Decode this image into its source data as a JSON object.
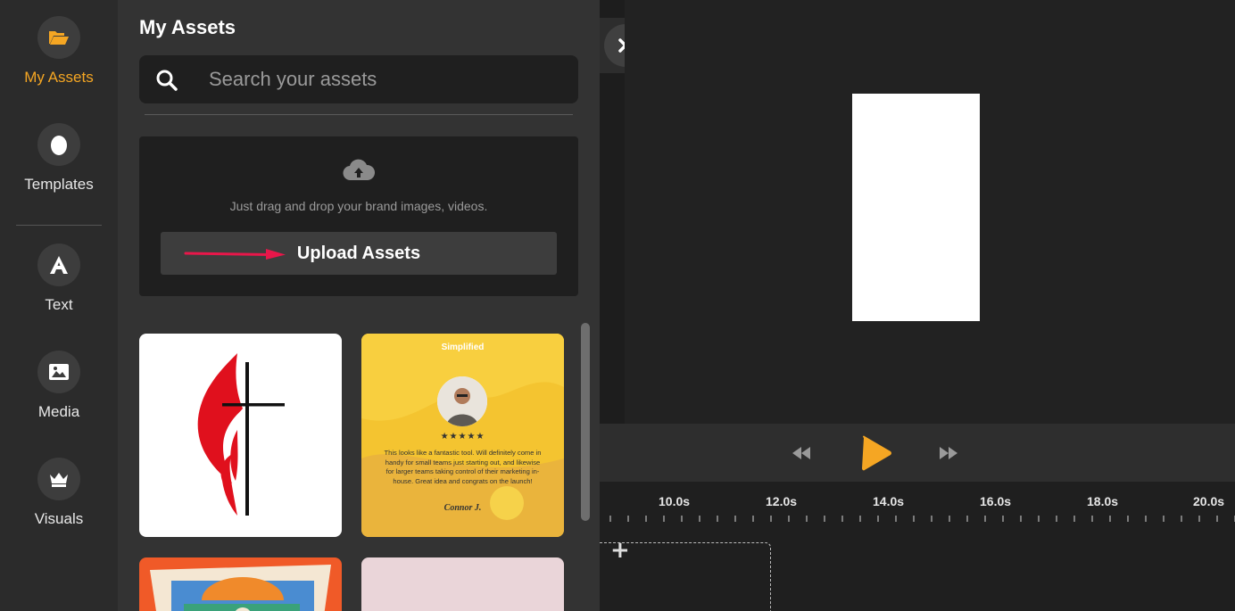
{
  "rail": {
    "items": [
      {
        "label": "My Assets",
        "icon": "folder-open-icon",
        "active": true
      },
      {
        "label": "Templates",
        "icon": "egg-icon",
        "active": false
      },
      {
        "label": "Text",
        "icon": "text-a-icon",
        "active": false
      },
      {
        "label": "Media",
        "icon": "image-icon",
        "active": false
      },
      {
        "label": "Visuals",
        "icon": "crown-icon",
        "active": false
      }
    ]
  },
  "panel": {
    "title": "My Assets",
    "search_placeholder": "Search your assets",
    "drop_text": "Just drag and drop your brand images, videos.",
    "upload_label": "Upload Assets",
    "testimonial": {
      "brand": "Simplified",
      "stars": "★★★★★",
      "quote": "This looks like a fantastic tool. Will definitely come in handy for small teams just starting out, and likewise for larger teams taking control of their marketing in-house. Great idea and congrats on the launch!",
      "signature": "Connor J."
    }
  },
  "timeline": {
    "ticks": [
      "10.0s",
      "12.0s",
      "14.0s",
      "16.0s",
      "18.0s",
      "20.0s"
    ]
  },
  "colors": {
    "accent": "#f5a623",
    "arrow": "#e8174a"
  }
}
